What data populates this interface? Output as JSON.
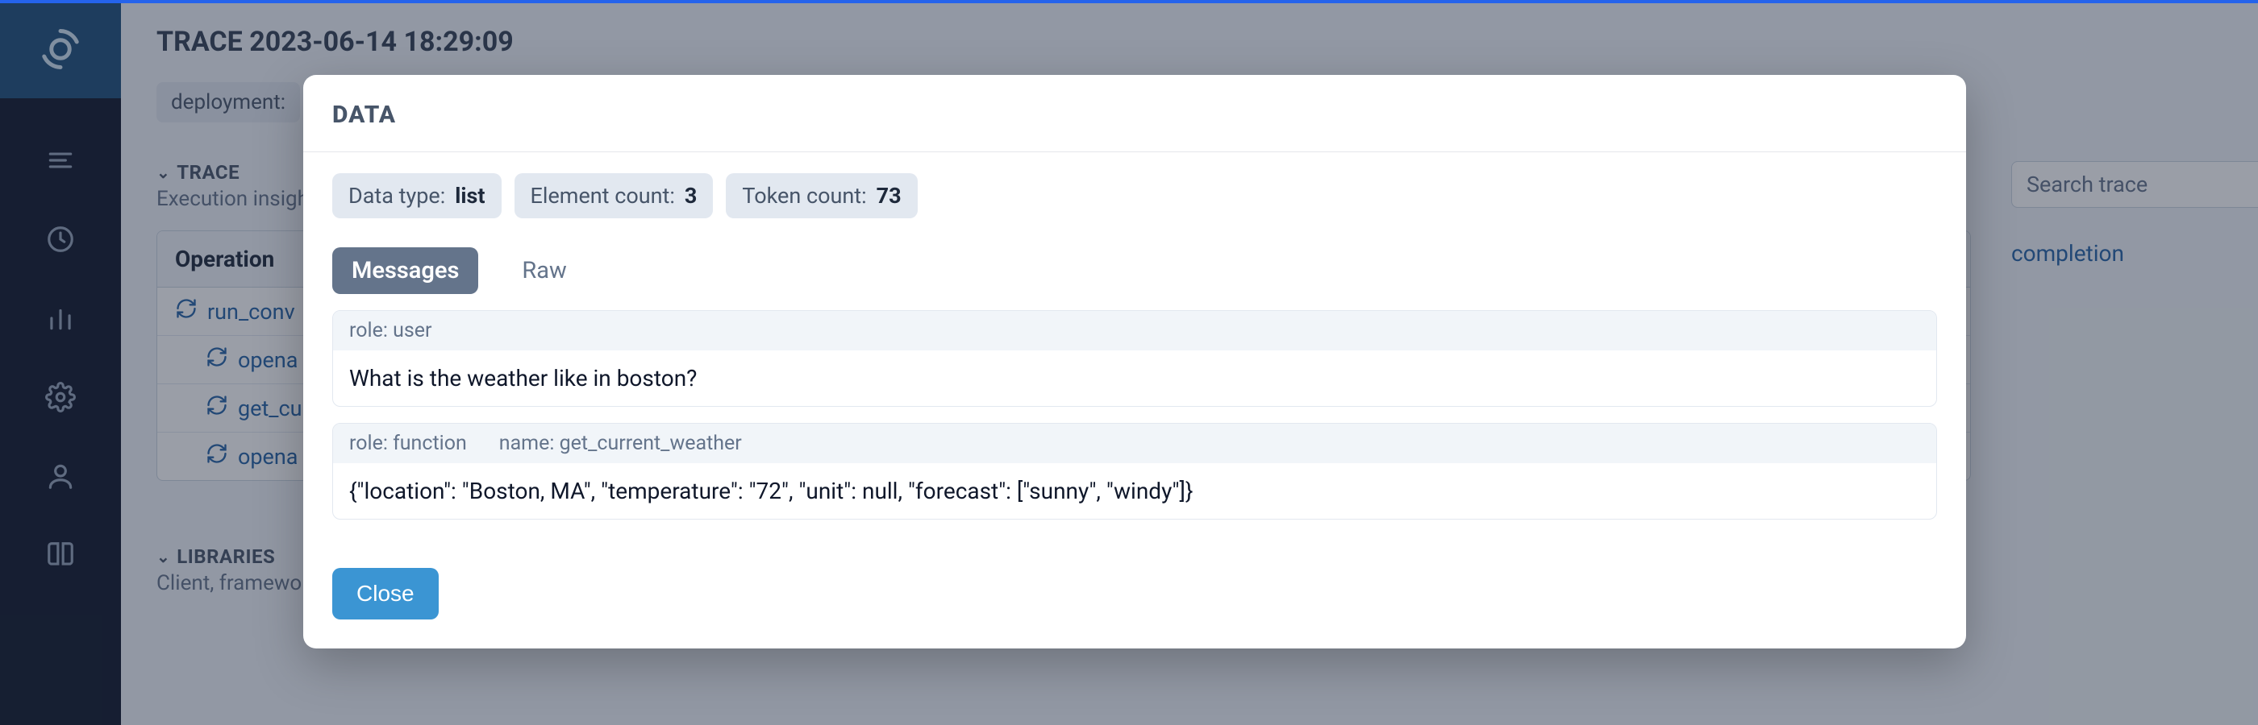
{
  "page": {
    "title": "TRACE 2023-06-14 18:29:09",
    "metaChip": "deployment:"
  },
  "trace_section": {
    "heading": "TRACE",
    "sub": "Execution insights",
    "column_header": "Operation",
    "rows": [
      {
        "label": "run_conv"
      },
      {
        "label": "opena"
      },
      {
        "label": "get_cu"
      },
      {
        "label": "opena"
      }
    ]
  },
  "search": {
    "placeholder": "Search trace"
  },
  "detail_link": "completion",
  "libraries": {
    "heading": "LIBRARIES",
    "sub": "Client, framework"
  },
  "modal": {
    "title": "DATA",
    "badges": {
      "data_type_label": "Data type:",
      "data_type_value": "list",
      "element_count_label": "Element count:",
      "element_count_value": "3",
      "token_count_label": "Token count:",
      "token_count_value": "73"
    },
    "tabs": {
      "messages": "Messages",
      "raw": "Raw"
    },
    "messages": [
      {
        "role_label": "role: user",
        "name_label": "",
        "content": "What is the weather like in boston?"
      },
      {
        "role_label": "role: function",
        "name_label": "name: get_current_weather",
        "content": "{\"location\": \"Boston, MA\", \"temperature\": \"72\", \"unit\": null, \"forecast\": [\"sunny\", \"windy\"]}"
      }
    ],
    "close": "Close"
  }
}
